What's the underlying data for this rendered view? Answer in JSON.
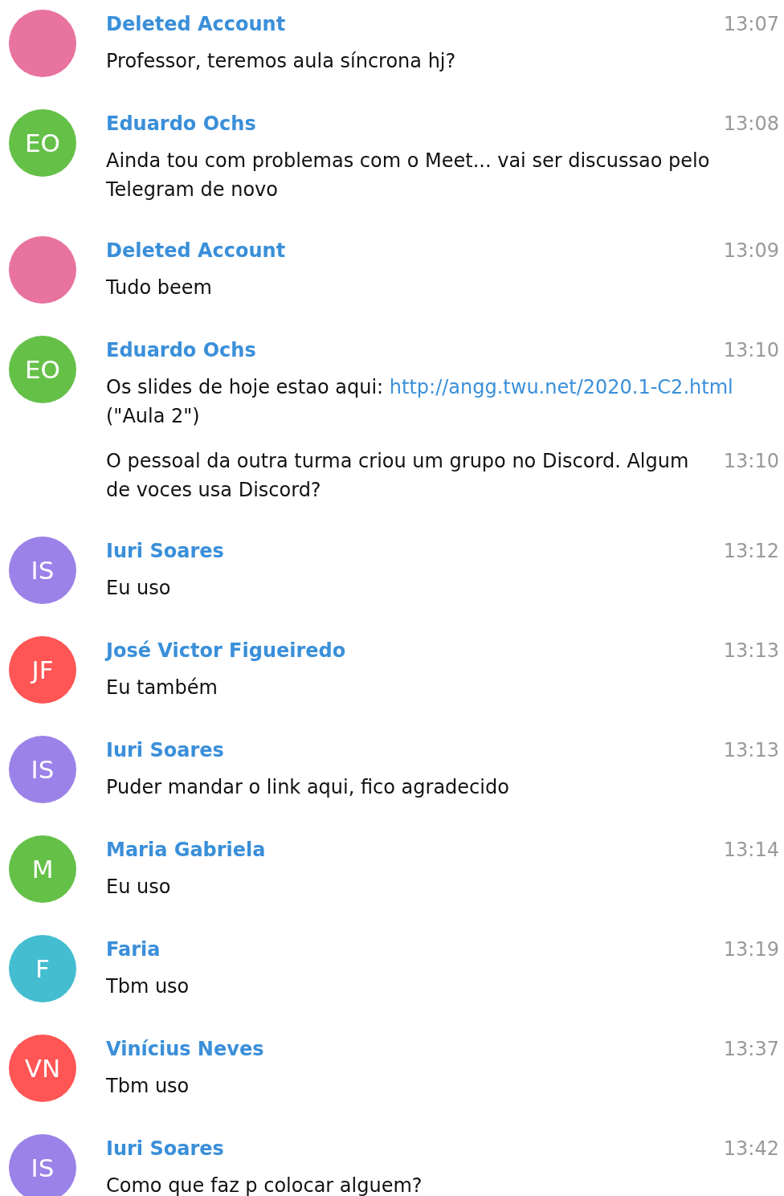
{
  "messages": [
    {
      "kind": "first",
      "color": "#e8739f",
      "name": "Deleted Account",
      "time": "13:07",
      "parts": [
        {
          "kind": "text",
          "text": "Professor, teremos aula síncrona hj?"
        }
      ]
    },
    {
      "kind": "first",
      "initials": "EO",
      "color": "#65c048",
      "name": "Eduardo Ochs",
      "time": "13:08",
      "parts": [
        {
          "kind": "text",
          "text": "Ainda tou com problemas com o Meet... vai ser discussao pelo Telegram de novo"
        }
      ]
    },
    {
      "kind": "first",
      "color": "#e8739f",
      "name": "Deleted Account",
      "time": "13:09",
      "parts": [
        {
          "kind": "text",
          "text": "Tudo beem"
        }
      ]
    },
    {
      "kind": "first",
      "initials": "EO",
      "color": "#65c048",
      "name": "Eduardo Ochs",
      "time": "13:10",
      "parts": [
        {
          "kind": "text",
          "text": "Os slides de hoje estao aqui: "
        },
        {
          "kind": "link",
          "text": "http://angg.twu.net/2020.1-C2.html"
        },
        {
          "kind": "text",
          "text": " (\"Aula 2\")"
        }
      ]
    },
    {
      "kind": "continued",
      "time": "13:10",
      "parts": [
        {
          "kind": "text",
          "text": "O pessoal da outra turma criou um grupo no Discord. Algum de voces usa Discord?"
        }
      ]
    },
    {
      "kind": "first",
      "initials": "IS",
      "color": "#9b82e8",
      "name": "Iuri Soares",
      "time": "13:12",
      "parts": [
        {
          "kind": "text",
          "text": "Eu uso"
        }
      ]
    },
    {
      "kind": "first",
      "initials": "JF",
      "color": "#ff5555",
      "name": "José Victor Figueiredo",
      "time": "13:13",
      "parts": [
        {
          "kind": "text",
          "text": "Eu também"
        }
      ]
    },
    {
      "kind": "first",
      "initials": "IS",
      "color": "#9b82e8",
      "name": "Iuri Soares",
      "time": "13:13",
      "parts": [
        {
          "kind": "text",
          "text": "Puder mandar o link aqui, fico agradecido"
        }
      ]
    },
    {
      "kind": "first",
      "initials": "M",
      "color": "#65c048",
      "name": "Maria Gabriela",
      "time": "13:14",
      "parts": [
        {
          "kind": "text",
          "text": "Eu uso"
        }
      ]
    },
    {
      "kind": "first",
      "initials": "F",
      "color": "#45bdd0",
      "name": "Faria",
      "time": "13:19",
      "parts": [
        {
          "kind": "text",
          "text": "Tbm uso"
        }
      ]
    },
    {
      "kind": "first",
      "initials": "VN",
      "color": "#ff5555",
      "name": "Vinícius Neves",
      "time": "13:37",
      "parts": [
        {
          "kind": "text",
          "text": "Tbm uso"
        }
      ]
    },
    {
      "kind": "first",
      "initials": "IS",
      "color": "#9b82e8",
      "name": "Iuri Soares",
      "time": "13:42",
      "parts": [
        {
          "kind": "text",
          "text": "Como que faz p colocar alguem?"
        }
      ]
    }
  ]
}
